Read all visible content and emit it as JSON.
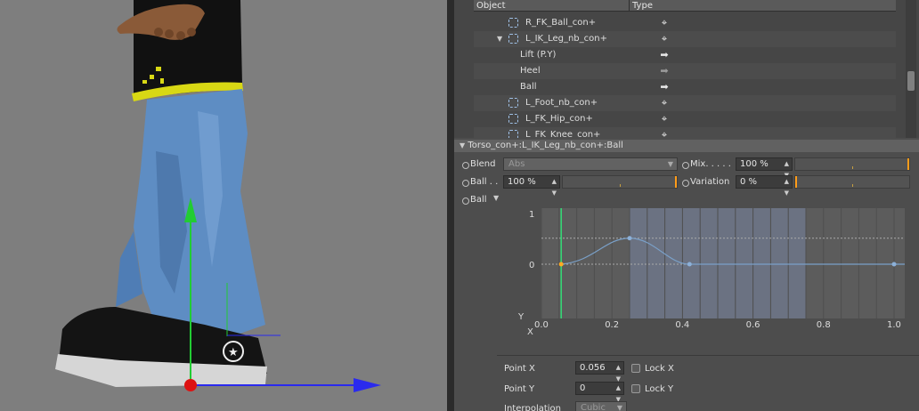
{
  "object_manager": {
    "columns": {
      "object": "Object",
      "type": "Type"
    },
    "rows": [
      {
        "label": "R_FK_Ball_con+",
        "type_icon": "crosshair-icon"
      },
      {
        "label": "L_IK_Leg_nb_con+",
        "type_icon": "crosshair-icon"
      },
      {
        "label": "Lift (P.Y)",
        "type_icon": "arrow-right-icon"
      },
      {
        "label": "Heel",
        "type_icon": "arrow-right-icon"
      },
      {
        "label": "Ball",
        "type_icon": "arrow-right-icon"
      },
      {
        "label": "L_Foot_nb_con+",
        "type_icon": "crosshair-icon"
      },
      {
        "label": "L_FK_Hip_con+",
        "type_icon": "crosshair-icon"
      },
      {
        "label": "L_FK_Knee_con+",
        "type_icon": "crosshair-icon"
      }
    ]
  },
  "attributes": {
    "title": "Torso_con+:L_IK_Leg_nb_con+:Ball",
    "blend": {
      "label": "Blend",
      "value": "Abs"
    },
    "mix": {
      "label": "Mix. . . . .",
      "value": "100 %",
      "fraction": 1.0
    },
    "ball": {
      "label": "Ball . .",
      "value": "100 %",
      "fraction": 1.0
    },
    "variation": {
      "label": "Variation",
      "value": "0 %",
      "fraction": 0.0
    },
    "ball_spline_label": "Ball",
    "spline": {
      "y_axis_label": "Y",
      "x_axis_label": "X",
      "y_ticks": [
        "1",
        "0"
      ],
      "x_ticks": [
        "0.0",
        "0.2",
        "0.4",
        "0.6",
        "0.8",
        "1.0"
      ],
      "points": [
        {
          "x": 0.056,
          "y": 0.0,
          "selected": true
        },
        {
          "x": 0.25,
          "y": 0.45,
          "selected": false
        },
        {
          "x": 0.42,
          "y": 0.0,
          "selected": false
        },
        {
          "x": 1.0,
          "y": 0.0,
          "selected": false
        }
      ],
      "colors": {
        "curve": "#7aa0c8",
        "selected_point": "#ffaa22",
        "point": "#8cb0d8",
        "cursor": "#33dd77"
      }
    },
    "point_x": {
      "label": "Point X",
      "value": "0.056",
      "lock": "Lock X"
    },
    "point_y": {
      "label": "Point Y",
      "value": "0",
      "lock": "Lock Y"
    },
    "interpolation": {
      "label": "Interpolation",
      "value": "Cubic"
    }
  },
  "viewport": {
    "colors": {
      "background": "#7e7e7e",
      "y_axis": "#22cc33",
      "x_axis": "#2a2aee",
      "origin": "#dd1111"
    }
  }
}
